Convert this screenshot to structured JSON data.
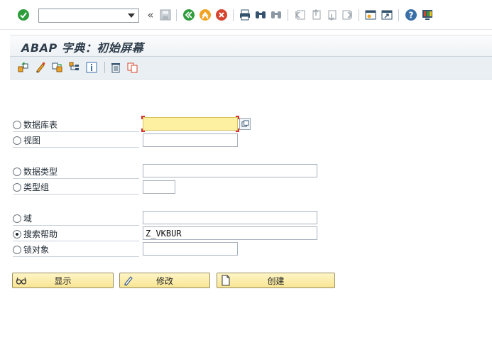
{
  "toolbar": {
    "command_value": "",
    "icons": [
      "enter-icon",
      "back-icon",
      "exit-icon",
      "cancel-icon",
      "save-icon",
      "print-icon",
      "find-icon",
      "find-next-icon",
      "first-page-icon",
      "prev-page-icon",
      "next-page-icon",
      "last-page-icon",
      "new-session-icon",
      "shortcut-icon",
      "help-icon",
      "customize-layout-icon"
    ],
    "collapse_glyph": "«"
  },
  "title": "ABAP 字典：初始屏幕",
  "app_toolbar": {
    "icons": [
      "other-object-icon",
      "change-icon",
      "copy-icon",
      "where-used-icon",
      "info-icon",
      "delete-icon",
      "rename-icon"
    ]
  },
  "form": {
    "options": [
      {
        "label": "数据库表",
        "value": "",
        "selected": false
      },
      {
        "label": "视图",
        "value": "",
        "selected": false
      },
      {
        "label": "数据类型",
        "value": "",
        "selected": false
      },
      {
        "label": "类型组",
        "value": "",
        "selected": false
      },
      {
        "label": "域",
        "value": "",
        "selected": false
      },
      {
        "label": "搜索帮助",
        "value": "Z_VKBUR",
        "selected": true
      },
      {
        "label": "锁对象",
        "value": "",
        "selected": false
      }
    ]
  },
  "buttons": {
    "display": "显示",
    "change": "修改",
    "create": "创建"
  },
  "colors": {
    "focus_field": "#fdf1a1",
    "button": "#f8e593",
    "accept_green": "#2e9d3c",
    "cancel_red": "#d6452e"
  }
}
